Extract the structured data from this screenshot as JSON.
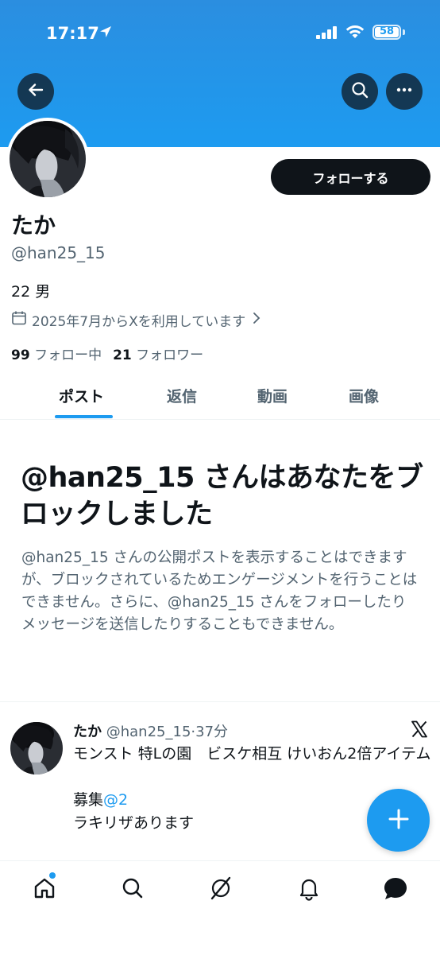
{
  "status_bar": {
    "time": "17:17",
    "battery": "58"
  },
  "profile": {
    "name": "たか",
    "handle": "@han25_15",
    "bio": "22 男",
    "joined": "2025年7月からXを利用しています",
    "following_count": "99",
    "following_label": "フォロー中",
    "followers_count": "21",
    "followers_label": "フォロワー",
    "follow_button": "フォローする"
  },
  "tabs": [
    {
      "label": "ポスト",
      "active": true
    },
    {
      "label": "返信",
      "active": false
    },
    {
      "label": "動画",
      "active": false
    },
    {
      "label": "画像",
      "active": false
    }
  ],
  "blocked": {
    "title": "@han25_15 さんはあなたをブロックしました",
    "body": "@han25_15 さんの公開ポストを表示することはできますが、ブロックされているためエンゲージメントを行うことはできません。さらに、@han25_15 さんをフォローしたりメッセージを送信したりすることもできません。"
  },
  "post": {
    "author": "たか",
    "handle": "@han25_15",
    "separator": "·",
    "time": "37分",
    "line1": "モンスト 特Lの園　ビスケ相互 けいおん2倍アイテム",
    "line2_prefix": "募集",
    "line2_mention": "@2",
    "line3": "ラキリザあります"
  },
  "icons": {
    "back": "back-arrow-icon",
    "search": "search-icon",
    "more": "more-icon",
    "calendar": "calendar-icon",
    "chevron": "chevron-right-icon",
    "x_logo": "x-logo-icon",
    "compose": "plus-icon",
    "nav": [
      "home-icon",
      "search-icon",
      "grok-icon",
      "bell-icon",
      "messages-icon"
    ]
  },
  "colors": {
    "accent": "#1d9bf0",
    "text": "#0f1419",
    "secondary": "#536471"
  }
}
